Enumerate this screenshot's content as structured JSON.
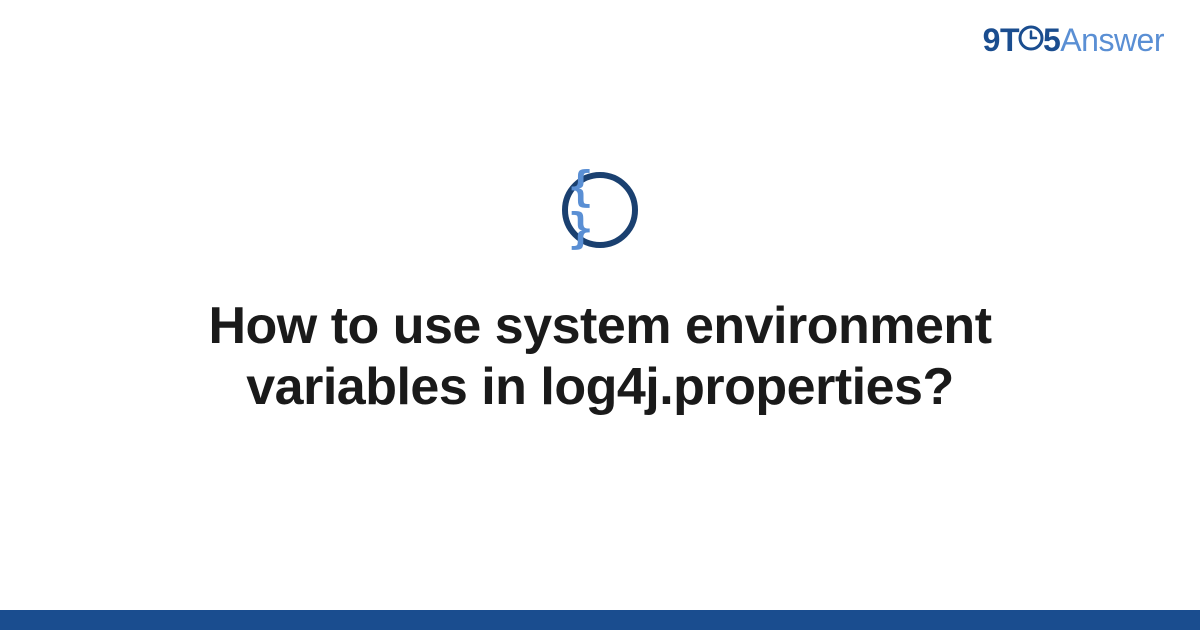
{
  "brand": {
    "prefix": "9T",
    "suffix": "5",
    "word": "Answer"
  },
  "badge": {
    "glyph": "{ }"
  },
  "title": "How to use system environment variables in log4j.properties?",
  "colors": {
    "brand_dark": "#1a4d8f",
    "brand_light": "#5a8fd4",
    "badge_ring": "#1a4070",
    "footer": "#1a4d8f"
  }
}
